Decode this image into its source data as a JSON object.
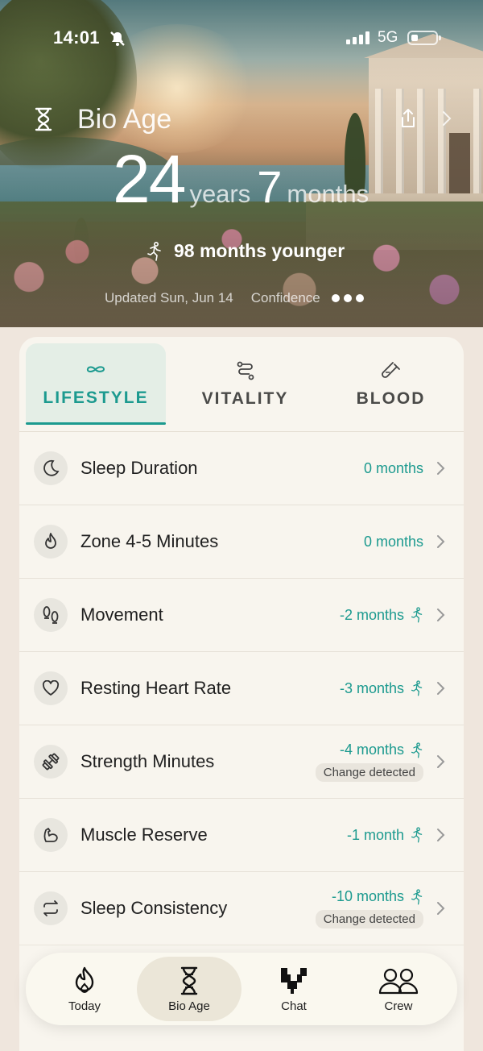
{
  "status_bar": {
    "time": "14:01",
    "network": "5G"
  },
  "hero": {
    "title": "Bio Age",
    "years_value": "24",
    "years_unit": "years",
    "months_value": "7",
    "months_unit": "months",
    "younger_text": "98 months younger",
    "updated_text": "Updated Sun, Jun 14",
    "confidence_label": "Confidence",
    "confidence_level": 3
  },
  "tabs": [
    {
      "label": "LIFESTYLE",
      "icon": "infinity-icon",
      "active": true
    },
    {
      "label": "VITALITY",
      "icon": "route-icon",
      "active": false
    },
    {
      "label": "BLOOD",
      "icon": "test-tube-icon",
      "active": false
    }
  ],
  "rows": [
    {
      "label": "Sleep Duration",
      "value": "0 months",
      "icon": "moon-icon",
      "badge": ""
    },
    {
      "label": "Zone 4-5 Minutes",
      "value": "0 months",
      "icon": "flame-icon",
      "badge": ""
    },
    {
      "label": "Movement",
      "value": "-2 months",
      "icon": "footprints-icon",
      "badge": ""
    },
    {
      "label": "Resting Heart Rate",
      "value": "-3 months",
      "icon": "heart-icon",
      "badge": ""
    },
    {
      "label": "Strength Minutes",
      "value": "-4 months",
      "icon": "dumbbell-icon",
      "badge": "Change detected"
    },
    {
      "label": "Muscle Reserve",
      "value": "-1 month",
      "icon": "biceps-icon",
      "badge": ""
    },
    {
      "label": "Sleep Consistency",
      "value": "-10 months",
      "icon": "repeat-icon",
      "badge": "Change detected"
    }
  ],
  "nav": [
    {
      "label": "Today",
      "icon": "flame-icon",
      "active": false
    },
    {
      "label": "Bio Age",
      "icon": "dna-icon",
      "active": true
    },
    {
      "label": "Chat",
      "icon": "chat-logo-icon",
      "active": false
    },
    {
      "label": "Crew",
      "icon": "people-icon",
      "active": false
    }
  ],
  "colors": {
    "accent": "#1c9a8f",
    "card_bg": "#f8f5ee"
  }
}
